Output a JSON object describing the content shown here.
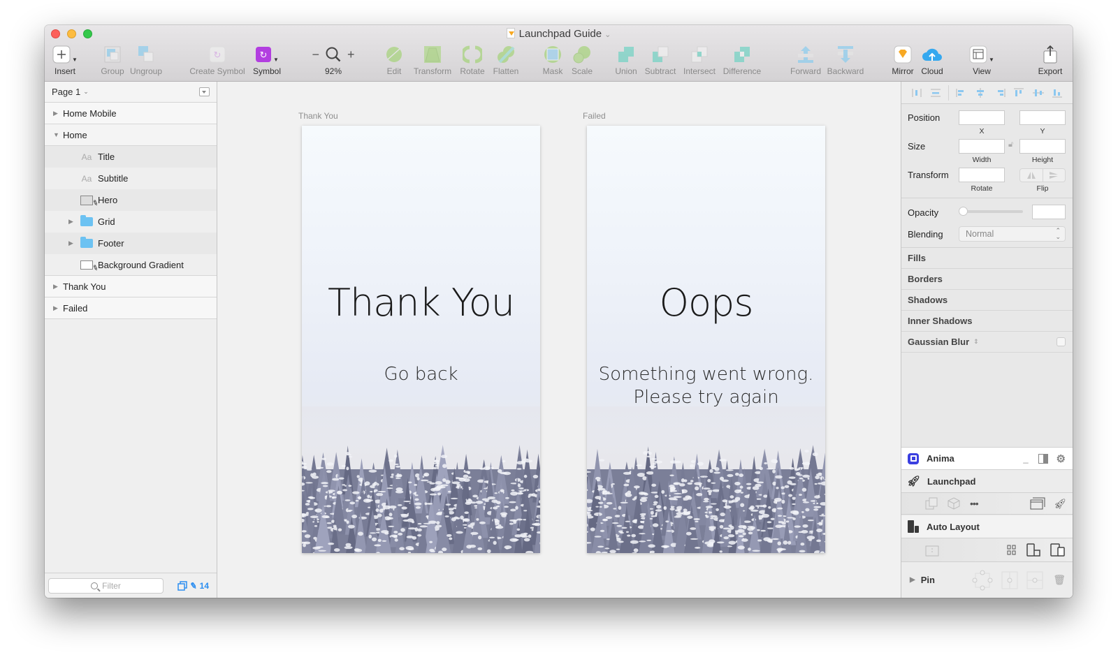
{
  "window": {
    "title": "Launchpad Guide"
  },
  "toolbar": {
    "insert": "Insert",
    "group": "Group",
    "ungroup": "Ungroup",
    "create_symbol": "Create Symbol",
    "symbol": "Symbol",
    "zoom_level": "92%",
    "zoom_out": "−",
    "zoom_in": "+",
    "edit": "Edit",
    "transform": "Transform",
    "rotate": "Rotate",
    "flatten": "Flatten",
    "mask": "Mask",
    "scale": "Scale",
    "union": "Union",
    "subtract": "Subtract",
    "intersect": "Intersect",
    "difference": "Difference",
    "forward": "Forward",
    "backward": "Backward",
    "mirror": "Mirror",
    "cloud": "Cloud",
    "view": "View",
    "export": "Export"
  },
  "sidebar": {
    "page": "Page 1",
    "layers": [
      {
        "name": "Home Mobile",
        "level": 0,
        "expanded": false
      },
      {
        "name": "Home",
        "level": 0,
        "expanded": true
      },
      {
        "name": "Title",
        "level": 1,
        "type": "text",
        "type_label": "Aa"
      },
      {
        "name": "Subtitle",
        "level": 1,
        "type": "text",
        "type_label": "Aa"
      },
      {
        "name": "Hero",
        "level": 1,
        "type": "image"
      },
      {
        "name": "Grid",
        "level": 1,
        "type": "group"
      },
      {
        "name": "Footer",
        "level": 1,
        "type": "group"
      },
      {
        "name": "Background Gradient",
        "level": 1,
        "type": "shape"
      },
      {
        "name": "Thank You",
        "level": 0,
        "expanded": false
      },
      {
        "name": "Failed",
        "level": 0,
        "expanded": false
      }
    ],
    "filter_placeholder": "Filter",
    "edited_count": "14"
  },
  "canvas": {
    "artboards": [
      {
        "label": "Thank You",
        "title": "Thank You",
        "subtitle_lines": [
          "Go back"
        ]
      },
      {
        "label": "Failed",
        "title": "Oops",
        "subtitle_lines": [
          "Something went wrong.",
          "Please try again"
        ]
      }
    ]
  },
  "inspector": {
    "position_label": "Position",
    "x_label": "X",
    "y_label": "Y",
    "size_label": "Size",
    "width_label": "Width",
    "height_label": "Height",
    "transform_label": "Transform",
    "rotate_label": "Rotate",
    "flip_label": "Flip",
    "opacity_label": "Opacity",
    "opacity_value": 0,
    "blending_label": "Blending",
    "blending_value": "Normal",
    "sections": [
      "Fills",
      "Borders",
      "Shadows",
      "Inner Shadows",
      "Gaussian Blur"
    ],
    "plugins": {
      "anima": "Anima",
      "launchpad": "Launchpad",
      "auto_layout": "Auto Layout",
      "pin": "Pin"
    }
  },
  "colors": {
    "symbol_accent": "#b23ee0",
    "anima_brand": "#3b3fe0",
    "cloud_blue": "#35a8ef",
    "selection_blue": "#2c8ef0"
  }
}
